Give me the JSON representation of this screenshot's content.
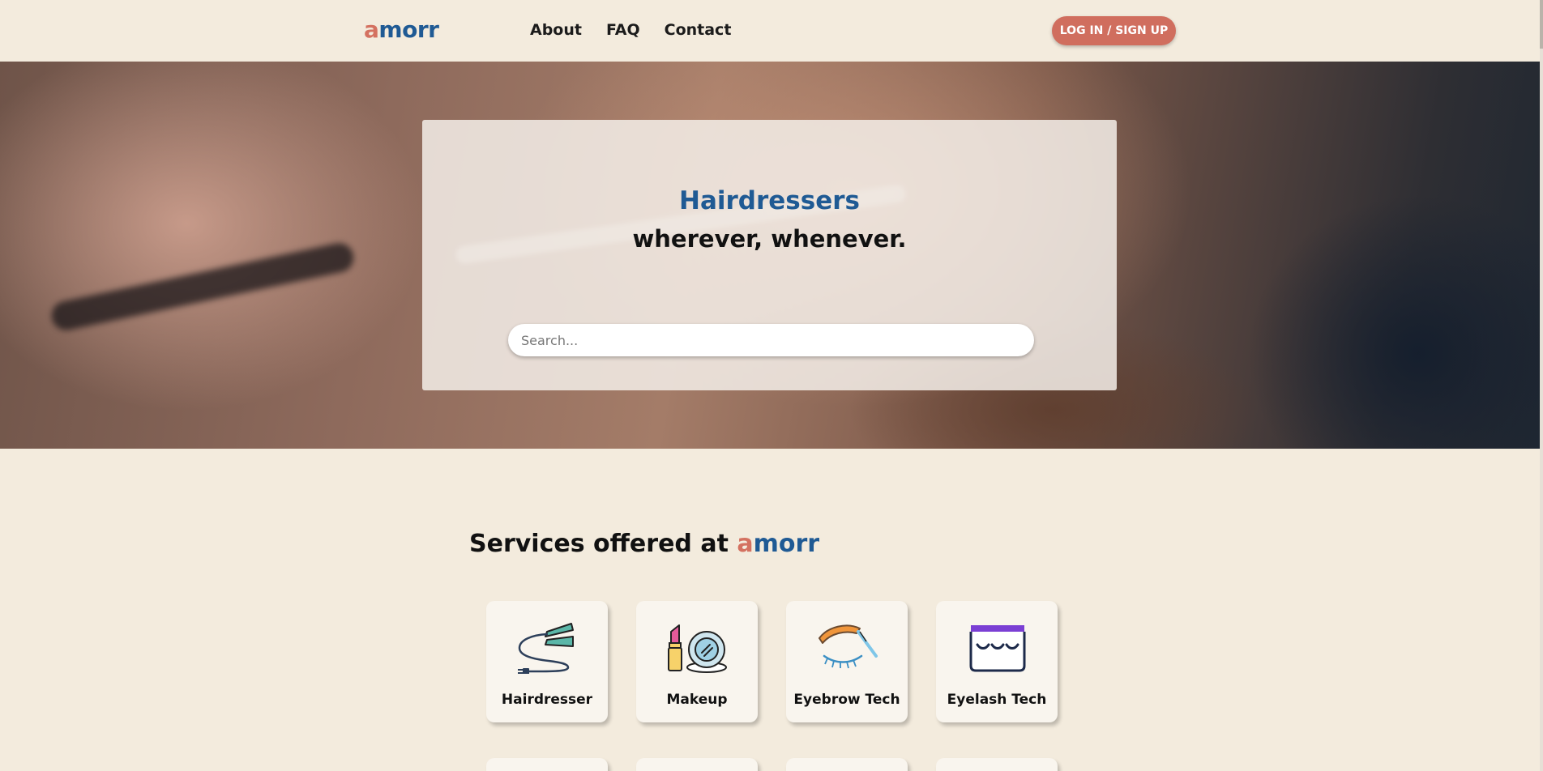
{
  "header": {
    "logo_a": "a",
    "logo_rest": "morr",
    "nav": [
      "About",
      "FAQ",
      "Contact"
    ],
    "login_label": "LOG IN / SIGN UP"
  },
  "hero": {
    "title": "Hairdressers",
    "subtitle": "wherever, whenever.",
    "search_placeholder": "Search..."
  },
  "services": {
    "title_prefix": "Services offered at ",
    "brand_a": "a",
    "brand_rest": "morr",
    "items": [
      {
        "label": "Hairdresser",
        "icon": "hair-straightener-icon"
      },
      {
        "label": "Makeup",
        "icon": "makeup-icon"
      },
      {
        "label": "Eyebrow Tech",
        "icon": "eyebrow-icon"
      },
      {
        "label": "Eyelash Tech",
        "icon": "eyelash-icon"
      }
    ]
  },
  "colors": {
    "background": "#f3ebdd",
    "brand_blue": "#1f5a94",
    "accent_coral": "#d47160"
  }
}
